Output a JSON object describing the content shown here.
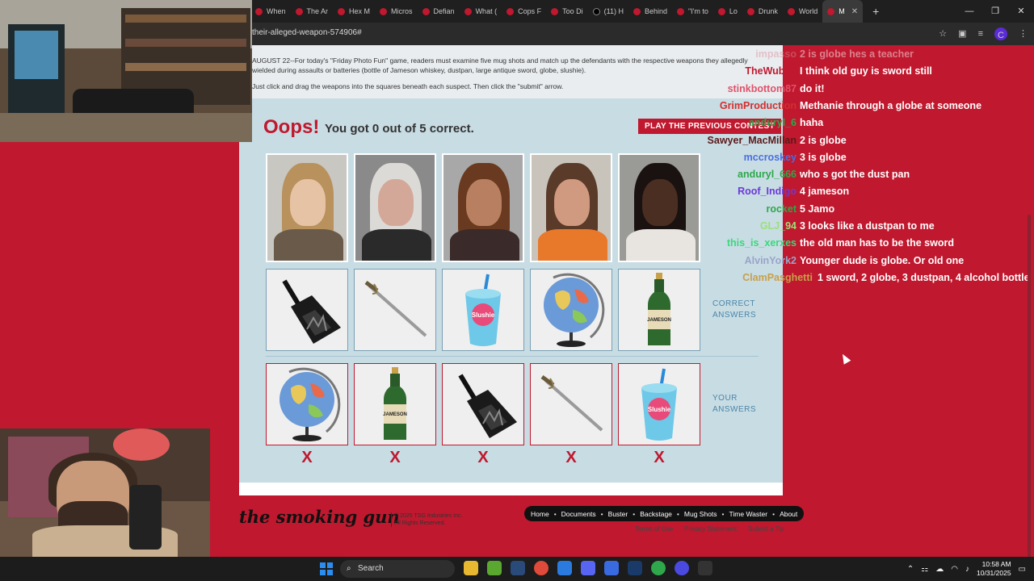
{
  "tabs": [
    {
      "label": "When",
      "icon": "tab-favicon"
    },
    {
      "label": "The Ar",
      "icon": "tab-favicon"
    },
    {
      "label": "Hex M",
      "icon": "tab-favicon"
    },
    {
      "label": "Micros",
      "icon": "tab-favicon"
    },
    {
      "label": "Defian",
      "icon": "tab-favicon"
    },
    {
      "label": "What (",
      "icon": "tab-favicon"
    },
    {
      "label": "Cops F",
      "icon": "tab-favicon"
    },
    {
      "label": "Too Di",
      "icon": "tab-favicon"
    },
    {
      "label": "(11) H",
      "icon": "x-icon"
    },
    {
      "label": "Behind",
      "icon": "tab-favicon"
    },
    {
      "label": "\"I'm to",
      "icon": "tab-favicon"
    },
    {
      "label": "Lo",
      "icon": "tab-favicon"
    },
    {
      "label": "Drunk",
      "icon": "tab-favicon"
    },
    {
      "label": "World",
      "icon": "tab-favicon"
    },
    {
      "label": "M",
      "icon": "tab-favicon"
    }
  ],
  "browser": {
    "url": "their-alleged-weapon-574906#",
    "new_tab": "+",
    "min": "—",
    "max": "❐",
    "close": "✕",
    "profile_initial": "C"
  },
  "page": {
    "intro": "AUGUST 22--For today's \"Friday Photo Fun\" game, readers must examine five mug shots and match up the defendants with the respective weapons they allegedly wielded during assaults or batteries (bottle of Jameson whiskey, dustpan, large antique sword, globe, slushie).",
    "instructions": "Just click and drag the weapons into the squares beneath each suspect. Then click the \"submit\" arrow.",
    "oops": "Oops!",
    "score": "You got 0 out of 5 correct.",
    "prev_contest": "PLAY THE PREVIOUS CONTEST",
    "correct_label_1": "CORRECT",
    "correct_label_2": "ANSWERS",
    "your_label_1": "YOUR",
    "your_label_2": "ANSWERS",
    "correct_answers": [
      "dustpan",
      "sword",
      "slushie",
      "globe",
      "jameson"
    ],
    "your_answers": [
      "globe",
      "jameson",
      "dustpan",
      "sword",
      "slushie"
    ],
    "marks": [
      "X",
      "X",
      "X",
      "X",
      "X"
    ],
    "slushie_text": "Slushie",
    "jameson_text": "JAMESON"
  },
  "footer": {
    "logo": "the smoking gun",
    "copyright_1": "© 2025 TSG Industries Inc.",
    "copyright_2": "All Rights Reserved.",
    "nav": [
      "Home",
      "Documents",
      "Buster",
      "Backstage",
      "Mug Shots",
      "Time Waster",
      "About"
    ],
    "links": [
      "Terms of Use",
      "Privacy Statement",
      "Submit a Tip"
    ]
  },
  "chat": [
    {
      "user": "impasso",
      "text": "2 is globe hes a teacher",
      "color": "#d98a94",
      "faded": true
    },
    {
      "user": "TheWubZ2",
      "text": "I think old guy is sword still",
      "color": "#c0182e"
    },
    {
      "user": "stinkbottom87",
      "text": "do it!",
      "color": "#e0526a"
    },
    {
      "user": "GrimProduction",
      "text": "Methanie through a globe at someone",
      "color": "#d42e2e"
    },
    {
      "user": "anduryl_6",
      "text": "haha",
      "color": "#2ea84a"
    },
    {
      "user": "Sawyer_MacMillan",
      "text": "2 is globe",
      "color": "#5a1a1a"
    },
    {
      "user": "mccroskey",
      "text": "3 is globe",
      "color": "#4a6ee0"
    },
    {
      "user": "anduryl_666",
      "text": "who s got the dust pan",
      "color": "#2ea84a"
    },
    {
      "user": "Roof_Indigo",
      "text": "4 jameson",
      "color": "#6a3ad8"
    },
    {
      "user": "rocket",
      "text": "5 Jamo",
      "color": "#2ea84a"
    },
    {
      "user": "GLJ_94",
      "text": "3 looks like a dustpan to me",
      "color": "#9be07a"
    },
    {
      "user": "this_is_xerxes",
      "text": "the old man has to be the sword",
      "color": "#3ad87a"
    },
    {
      "user": "AlvinYork2",
      "text": "Younger dude is globe. Or old one",
      "color": "#9aa4c8"
    },
    {
      "user": "ClamPasghetti",
      "text": "1 sword, 2 globe, 3 dustpan, 4 alcohol bottle",
      "color": "#c8a04a"
    }
  ],
  "taskbar": {
    "search": "Search",
    "time": "10:58 AM",
    "date": "10/31/2025"
  }
}
